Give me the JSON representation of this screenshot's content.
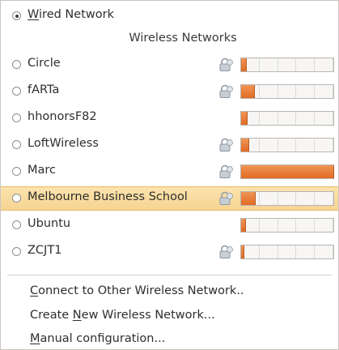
{
  "wired": {
    "label_mnemonic": "W",
    "label_rest": "ired Network",
    "selected": true
  },
  "wireless_title": "Wireless Networks",
  "networks": [
    {
      "name": "Circle",
      "secured": true,
      "signal": 0.05
    },
    {
      "name": "fARTa",
      "secured": true,
      "signal": 0.14
    },
    {
      "name": "hhonorsF82",
      "secured": false,
      "signal": 0.06
    },
    {
      "name": "LoftWireless",
      "secured": true,
      "signal": 0.08
    },
    {
      "name": "Marc",
      "secured": true,
      "signal": 1.0
    },
    {
      "name": "Melbourne Business School",
      "secured": true,
      "signal": 0.15,
      "highlighted": true
    },
    {
      "name": "Ubuntu",
      "secured": false,
      "signal": 0.04
    },
    {
      "name": "ZCJT1",
      "secured": true,
      "signal": 0.03
    }
  ],
  "actions": [
    {
      "mnemonic": "C",
      "before": "",
      "after": "onnect to Other Wireless Network.."
    },
    {
      "mnemonic": "N",
      "before": "Create ",
      "after": "ew Wireless Network..."
    },
    {
      "mnemonic": "M",
      "before": "",
      "after": "anual configuration..."
    }
  ],
  "icons": {
    "lock": "lock-icon"
  },
  "colors": {
    "highlight": "#f8d99b",
    "signal": "#e8783a"
  }
}
